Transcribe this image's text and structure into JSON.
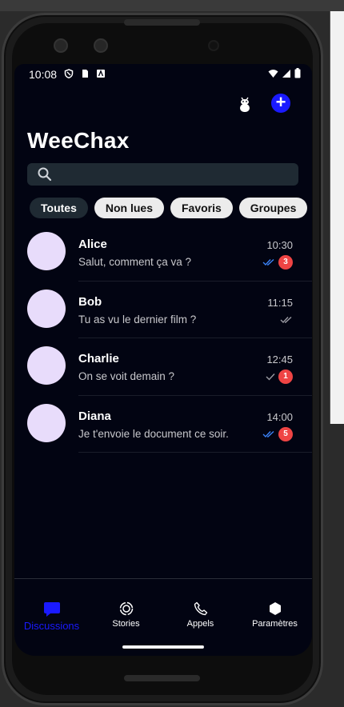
{
  "status_bar": {
    "time": "10:08"
  },
  "header": {
    "app_title": "WeeChax"
  },
  "search": {
    "placeholder": ""
  },
  "filters": [
    {
      "label": "Toutes",
      "active": true
    },
    {
      "label": "Non lues",
      "active": false
    },
    {
      "label": "Favoris",
      "active": false
    },
    {
      "label": "Groupes",
      "active": false
    }
  ],
  "chats": [
    {
      "name": "Alice",
      "message": "Salut, comment ça va ?",
      "time": "10:30",
      "read_status": "double-check-blue",
      "unread": "3"
    },
    {
      "name": "Bob",
      "message": "Tu as vu le dernier film ?",
      "time": "11:15",
      "read_status": "double-check-gray",
      "unread": ""
    },
    {
      "name": "Charlie",
      "message": "On se voit demain ?",
      "time": "12:45",
      "read_status": "single-check-gray",
      "unread": "1"
    },
    {
      "name": "Diana",
      "message": "Je t'envoie le document ce soir.",
      "time": "14:00",
      "read_status": "double-check-blue",
      "unread": "5"
    }
  ],
  "bottom_nav": [
    {
      "label": "Discussions",
      "icon": "chat-bubble-icon",
      "active": true
    },
    {
      "label": "Stories",
      "icon": "stories-icon",
      "active": false
    },
    {
      "label": "Appels",
      "icon": "phone-icon",
      "active": false
    },
    {
      "label": "Paramètres",
      "icon": "hexagon-icon",
      "active": false
    }
  ],
  "colors": {
    "background": "#020412",
    "accent": "#1a1aff",
    "badge": "#ef4444",
    "avatar": "#e8dcfb",
    "check_blue": "#3b82f6"
  }
}
